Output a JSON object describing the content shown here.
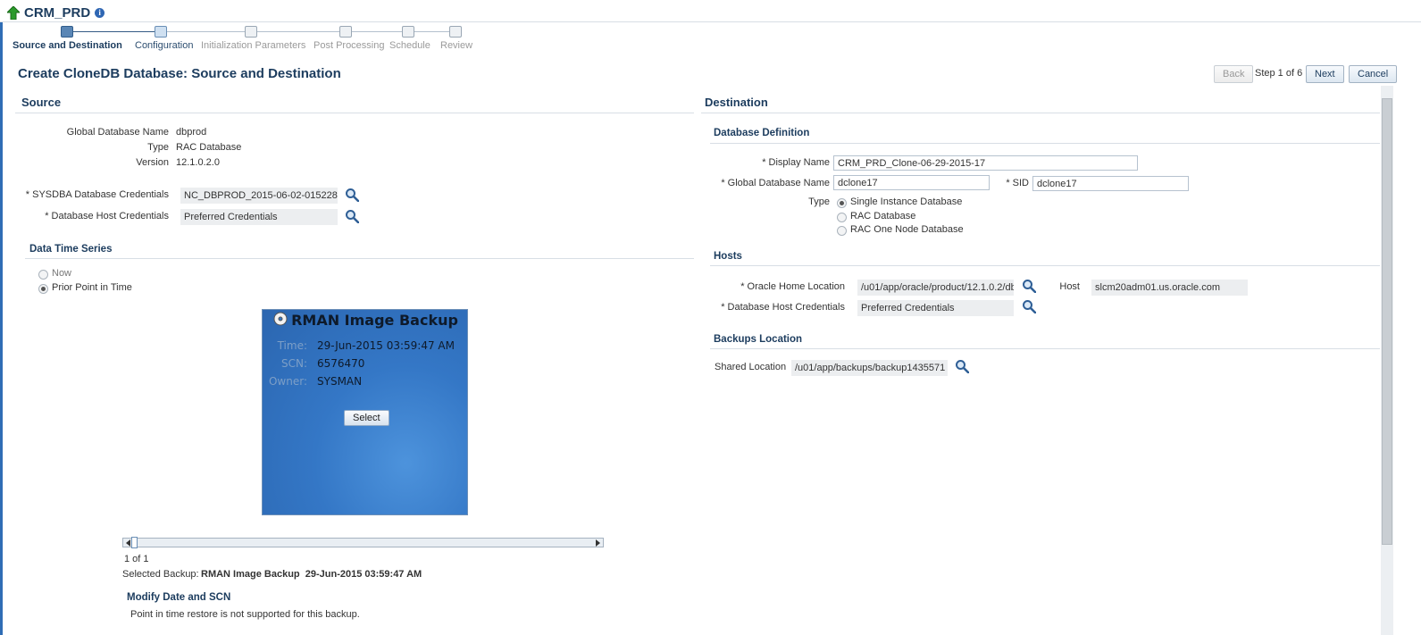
{
  "header": {
    "title": "CRM_PRD",
    "info_glyph": "i"
  },
  "train": {
    "steps": [
      {
        "label": "Source and Destination",
        "state": "current"
      },
      {
        "label": "Configuration",
        "state": "next"
      },
      {
        "label": "Initialization Parameters",
        "state": "todo"
      },
      {
        "label": "Post Processing",
        "state": "todo"
      },
      {
        "label": "Schedule",
        "state": "todo"
      },
      {
        "label": "Review",
        "state": "todo"
      }
    ]
  },
  "page": {
    "heading": "Create CloneDB Database: Source and Destination",
    "back_label": "Back",
    "step_text": "Step 1 of 6",
    "next_label": "Next",
    "cancel_label": "Cancel"
  },
  "source": {
    "heading": "Source",
    "global_db_name_label": "Global Database Name",
    "global_db_name": "dbprod",
    "type_label": "Type",
    "type": "RAC Database",
    "version_label": "Version",
    "version": "12.1.0.2.0",
    "sysdba_label": "* SYSDBA Database Credentials",
    "sysdba_value": "NC_DBPROD_2015-06-02-015228",
    "host_cred_label": "* Database Host Credentials",
    "host_cred_value": "Preferred Credentials"
  },
  "data_time_series": {
    "heading": "Data Time Series",
    "options": [
      {
        "label": "Now",
        "checked": false
      },
      {
        "label": "Prior Point in Time",
        "checked": true
      }
    ]
  },
  "backup_card": {
    "title": "RMAN Image Backup",
    "time_label": "Time:",
    "time": "29-Jun-2015 03:59:47 AM",
    "scn_label": "SCN:",
    "scn": "6576470",
    "owner_label": "Owner:",
    "owner": "SYSMAN",
    "select_label": "Select"
  },
  "carousel": {
    "page_text": "1 of 1",
    "selected_label": "Selected Backup:",
    "selected_value": "RMAN Image Backup  29-Jun-2015 03:59:47 AM"
  },
  "modify": {
    "heading": "Modify Date and SCN",
    "note": "Point in time restore is not supported for this backup."
  },
  "destination": {
    "heading": "Destination",
    "db_def_heading": "Database Definition",
    "display_name_label": "* Display Name",
    "display_name": "CRM_PRD_Clone-06-29-2015-17",
    "global_db_name_label": "* Global Database Name",
    "global_db_name": "dclone17",
    "sid_label": "* SID",
    "sid": "dclone17",
    "type_label": "Type",
    "type_options": [
      {
        "label": "Single Instance Database",
        "checked": true
      },
      {
        "label": "RAC Database",
        "checked": false
      },
      {
        "label": "RAC One Node Database",
        "checked": false
      }
    ],
    "hosts_heading": "Hosts",
    "oracle_home_label": "* Oracle Home Location",
    "oracle_home": "/u01/app/oracle/product/12.1.0.2/db",
    "host_label": "Host",
    "host": "slcm20adm01.us.oracle.com",
    "db_host_cred_label": "* Database Host Credentials",
    "db_host_cred": "Preferred Credentials",
    "backups_heading": "Backups Location",
    "shared_location_label": "Shared Location",
    "shared_location": "/u01/app/backups/backup1435571"
  },
  "icons": {
    "nav_up": "green-up-arrow-icon",
    "info": "info-icon",
    "search": "magnifier-search-icon"
  },
  "colors": {
    "heading": "#1c3c5e",
    "accent": "#2f6db5",
    "card": "#3477c6"
  }
}
